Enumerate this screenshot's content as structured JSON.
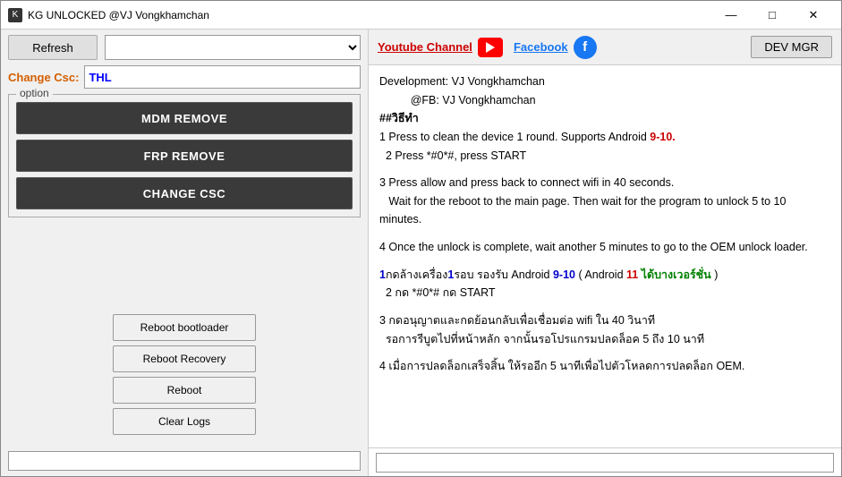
{
  "titlebar": {
    "icon": "K",
    "title": "KG UNLOCKED @VJ Vongkhamchan",
    "minimize": "—",
    "maximize": "□",
    "close": "✕"
  },
  "toplinks": {
    "youtube_label": "Youtube Channel",
    "facebook_label": "Facebook",
    "devmgr_label": "DEV MGR"
  },
  "leftpanel": {
    "refresh_label": "Refresh",
    "dropdown_placeholder": "",
    "csc_label": "Change Csc:",
    "csc_value": "THL",
    "option_legend": "option",
    "mdm_btn": "MDM REMOVE",
    "frp_btn": "FRP REMOVE",
    "csc_btn": "CHANGE CSC",
    "reboot_bootloader_btn": "Reboot bootloader",
    "reboot_recovery_btn": "Reboot Recovery",
    "reboot_btn": "Reboot",
    "clear_logs_btn": "Clear Logs"
  },
  "rightpanel": {
    "lines": [
      {
        "type": "normal",
        "text": "Development:  VJ Vongkhamchan"
      },
      {
        "type": "normal",
        "text": "          @FB: VJ Vongkhamchan"
      },
      {
        "type": "bold",
        "text": "##วิธีทำ"
      },
      {
        "type": "mixed",
        "parts": [
          {
            "text": "1 Press to clean the device 1 round. Supports Android ",
            "style": "normal"
          },
          {
            "text": "9-10.",
            "style": "red"
          }
        ]
      },
      {
        "type": "normal",
        "text": "  2 Press *#0*#, press START"
      },
      {
        "type": "normal",
        "text": ""
      },
      {
        "type": "normal",
        "text": "3 Press allow and press back to connect wifi in 40 seconds."
      },
      {
        "type": "normal",
        "text": "   Wait for the reboot to the main page. Then wait for the program to unlock 5 to 10 minutes."
      },
      {
        "type": "normal",
        "text": ""
      },
      {
        "type": "normal",
        "text": "4 Once the unlock is complete, wait another 5 minutes to go to the OEM unlock loader."
      },
      {
        "type": "normal",
        "text": ""
      },
      {
        "type": "thai1",
        "text": "1กดล้างเครื่อง1รอบ รองรับ Android 9-10 ( Android 11 ได้บางเวอร์ชั่น )"
      },
      {
        "type": "normal",
        "text": "  2 กด *#0*# กด START"
      },
      {
        "type": "normal",
        "text": ""
      },
      {
        "type": "normal",
        "text": "3 กดอนุญาตและกดย้อนกลับเพื่อเชื่อมต่อ wifi ใน 40 วินาที"
      },
      {
        "type": "normal",
        "text": "  รอการรีบูตไปที่หน้าหลัก จากนั้นรอโปรแกรมปลดล็อค 5 ถึง 10 นาที"
      },
      {
        "type": "normal",
        "text": ""
      },
      {
        "type": "normal",
        "text": "4 เมื่อการปลดล็อกเสร็จสิ้น ให้รออีก 5 นาทีเพื่อไปตัวโหลดการปลดล็อก OEM."
      }
    ]
  }
}
